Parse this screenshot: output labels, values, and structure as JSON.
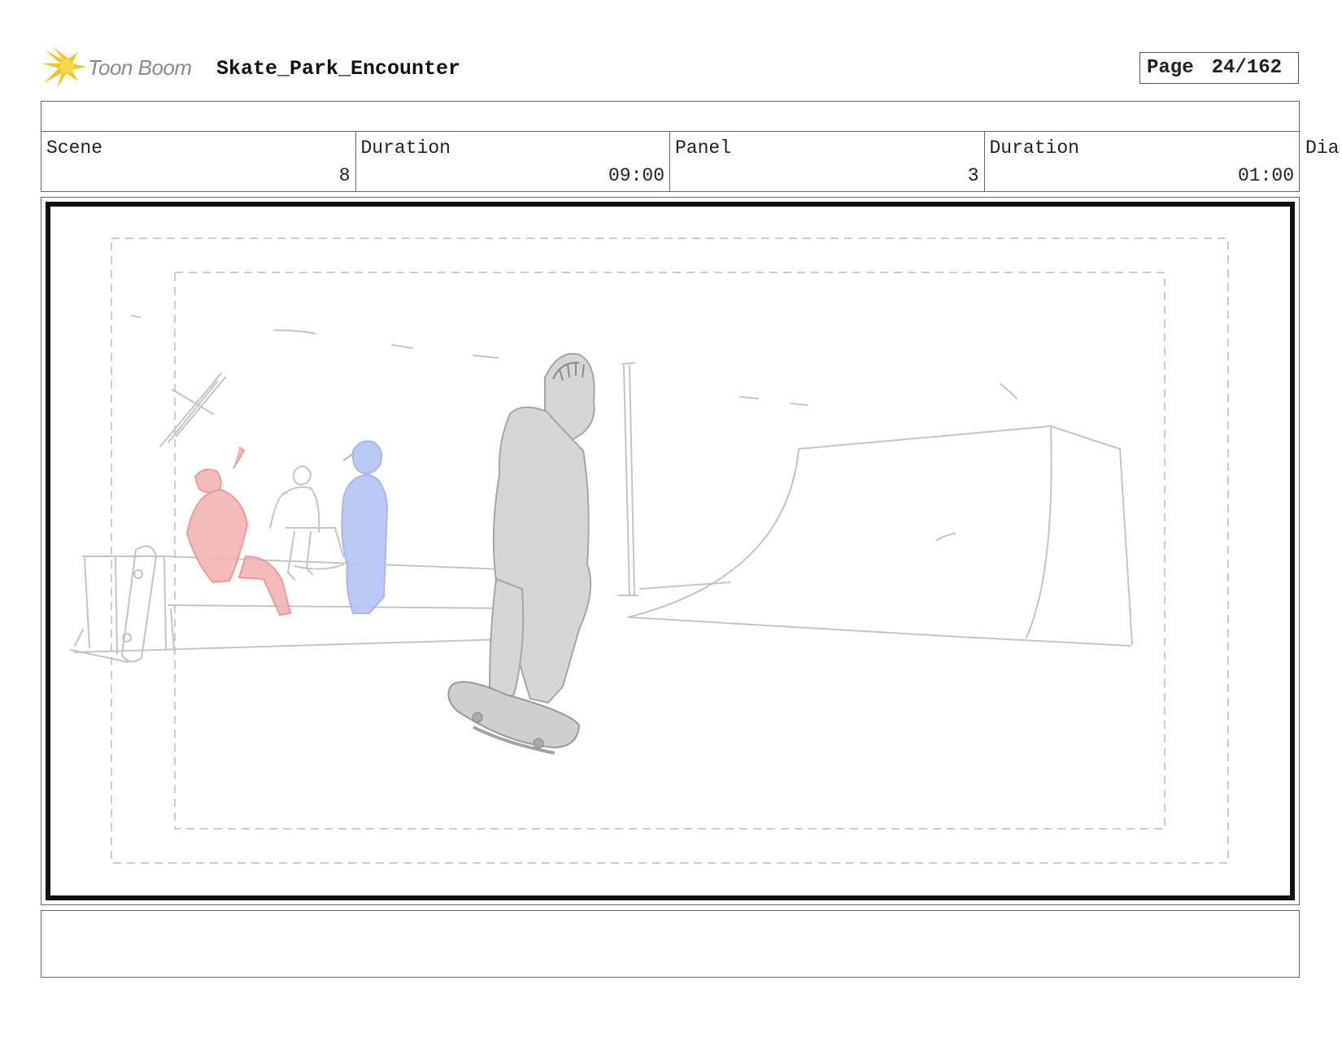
{
  "header": {
    "logo_text": "Toon Boom",
    "project_title": "Skate_Park_Encounter",
    "page_label": "Page",
    "page_number": "24/162"
  },
  "info": {
    "scene_label": "Scene",
    "scene_value": "8",
    "scene_duration_label": "Duration",
    "scene_duration_value": "09:00",
    "panel_label": "Panel",
    "panel_value": "3",
    "panel_duration_label": "Duration",
    "panel_duration_value": "01:00",
    "dialogue_label_partial": "Dia"
  },
  "colors": {
    "logo_star": "#f5c518",
    "logo_text": "#8a8a8a",
    "sketch_gray": "#b9b9b9",
    "sketch_red": "#f2a6a6",
    "sketch_blue": "#a9b8f2"
  }
}
